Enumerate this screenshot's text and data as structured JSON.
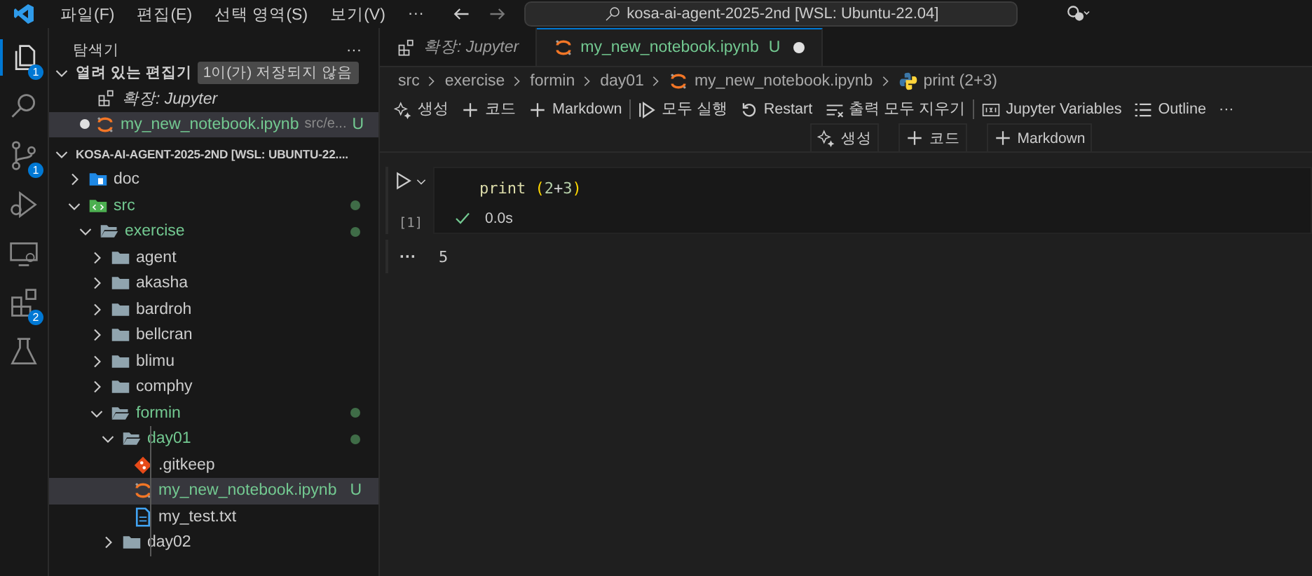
{
  "menu": [
    "파일(F)",
    "편집(E)",
    "선택 영역(S)",
    "보기(V)",
    "···"
  ],
  "command_center": {
    "text": "kosa-ai-agent-2025-2nd [WSL: Ubuntu-22.04]"
  },
  "activity_bar": [
    {
      "kind": "explorer",
      "selected": true,
      "badge": "1"
    },
    {
      "kind": "search",
      "selected": false
    },
    {
      "kind": "source-control",
      "selected": false,
      "badge": "1"
    },
    {
      "kind": "run",
      "selected": false
    },
    {
      "kind": "remote",
      "selected": false
    },
    {
      "kind": "extensions",
      "selected": false,
      "badge": "2"
    },
    {
      "kind": "testing",
      "selected": false
    }
  ],
  "sidebar": {
    "title": "탐색기",
    "more": "···",
    "open_editors": {
      "label": "열려 있는 편집기",
      "badge": "1이(가) 저장되지 않음",
      "expanded": true,
      "items": [
        {
          "kind": "extension",
          "name": "확장: Jupyter",
          "dirty": false,
          "selected": false
        },
        {
          "kind": "notebook",
          "name": "my_new_notebook.ipynb",
          "path": "src/e...",
          "status": "U",
          "dirty": true,
          "selected": true
        }
      ]
    },
    "workspace": {
      "label": "KOSA-AI-AGENT-2025-2ND [WSL: UBUNTU-22....",
      "expanded": true,
      "tree": [
        {
          "kind": "doc-folder",
          "name": "doc",
          "expanded": false,
          "changed": false,
          "selected": false
        },
        {
          "kind": "src-folder",
          "name": "src",
          "expanded": true,
          "changed": true,
          "selected": false,
          "children": [
            {
              "kind": "folder",
              "name": "exercise",
              "expanded": true,
              "changed": true,
              "selected": false,
              "children": [
                {
                  "kind": "folder",
                  "name": "agent",
                  "expanded": false,
                  "changed": false,
                  "selected": false
                },
                {
                  "kind": "folder",
                  "name": "akasha",
                  "expanded": false,
                  "changed": false,
                  "selected": false
                },
                {
                  "kind": "folder",
                  "name": "bardroh",
                  "expanded": false,
                  "changed": false,
                  "selected": false
                },
                {
                  "kind": "folder",
                  "name": "bellcran",
                  "expanded": false,
                  "changed": false,
                  "selected": false
                },
                {
                  "kind": "folder",
                  "name": "blimu",
                  "expanded": false,
                  "changed": false,
                  "selected": false
                },
                {
                  "kind": "folder",
                  "name": "comphy",
                  "expanded": false,
                  "changed": false,
                  "selected": false
                },
                {
                  "kind": "folder",
                  "name": "formin",
                  "expanded": true,
                  "changed": true,
                  "selected": false,
                  "children": [
                    {
                      "kind": "folder",
                      "name": "day01",
                      "expanded": true,
                      "changed": true,
                      "selected": false,
                      "children": [
                        {
                          "kind": "gitkeep",
                          "name": ".gitkeep",
                          "changed": false,
                          "selected": false
                        },
                        {
                          "kind": "notebook",
                          "name": "my_new_notebook.ipynb",
                          "changed": true,
                          "status": "U",
                          "selected": true
                        },
                        {
                          "kind": "text",
                          "name": "my_test.txt",
                          "changed": false,
                          "selected": false
                        }
                      ]
                    },
                    {
                      "kind": "folder",
                      "name": "day02",
                      "expanded": false,
                      "changed": false,
                      "selected": false
                    }
                  ]
                }
              ]
            }
          ]
        }
      ]
    }
  },
  "tabs": [
    {
      "kind": "extension",
      "label": "확장: Jupyter",
      "selected": false,
      "dirty": false
    },
    {
      "kind": "notebook",
      "label": "my_new_notebook.ipynb",
      "status": "U",
      "selected": true,
      "dirty": true
    }
  ],
  "breadcrumbs": [
    {
      "kind": "plain",
      "text": "src"
    },
    {
      "kind": "plain",
      "text": "exercise"
    },
    {
      "kind": "plain",
      "text": "formin"
    },
    {
      "kind": "plain",
      "text": "day01"
    },
    {
      "kind": "notebook",
      "text": "my_new_notebook.ipynb"
    },
    {
      "kind": "python",
      "text": "print (2+3)"
    }
  ],
  "toolbar": [
    {
      "kind": "sparkle",
      "label": "생성"
    },
    {
      "kind": "plus",
      "label": "코드"
    },
    {
      "kind": "plus",
      "label": "Markdown"
    },
    {
      "kind": "separator"
    },
    {
      "kind": "run-all",
      "label": "모두 실행"
    },
    {
      "kind": "restart",
      "label": "Restart"
    },
    {
      "kind": "clear",
      "label": "출력 모두 지우기"
    },
    {
      "kind": "separator"
    },
    {
      "kind": "variables",
      "label": "Jupyter Variables"
    },
    {
      "kind": "outline",
      "label": "Outline"
    },
    {
      "kind": "more",
      "label": "···"
    }
  ],
  "insert_bar": [
    {
      "kind": "sparkle",
      "label": "생성"
    },
    {
      "kind": "plus",
      "label": "코드"
    },
    {
      "kind": "plus",
      "label": "Markdown"
    }
  ],
  "cell": {
    "code_parts": [
      {
        "kind": "func",
        "text": "print"
      },
      {
        "kind": "paren",
        "text": "("
      },
      {
        "kind": "num",
        "text": "2"
      },
      {
        "kind": "op",
        "text": "+"
      },
      {
        "kind": "num",
        "text": "3"
      },
      {
        "kind": "paren",
        "text": ")"
      }
    ],
    "exec_count": "[1]",
    "succeeded": true,
    "duration": "0.0s",
    "output_more": "···",
    "output": "5"
  }
}
